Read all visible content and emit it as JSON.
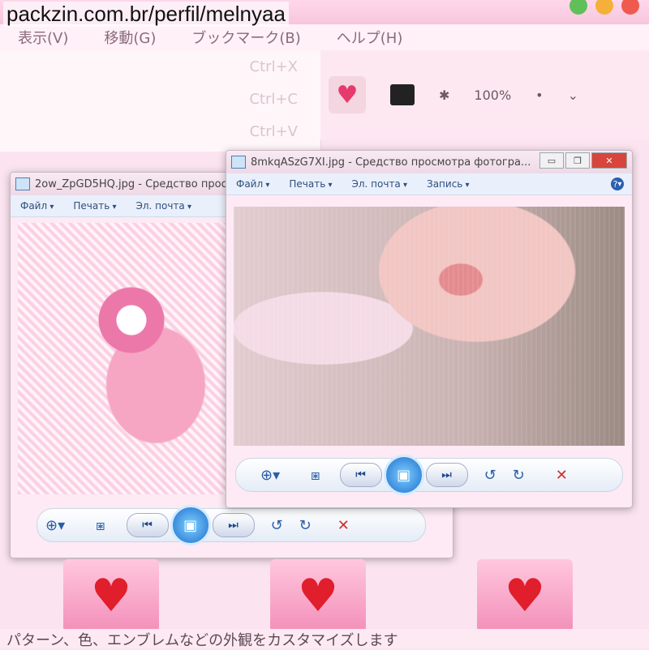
{
  "watermark": "packzin.com.br/perfil/melnyaa",
  "menubar": {
    "items": [
      "表示(V)",
      "移動(G)",
      "ブックマーク(B)",
      "ヘルプ(H)"
    ]
  },
  "dropdown": {
    "items": [
      {
        "label": "",
        "shortcut": "Ctrl+X"
      },
      {
        "label": "",
        "shortcut": "Ctrl+C"
      },
      {
        "label": "",
        "shortcut": "Ctrl+V"
      }
    ]
  },
  "toolbar": {
    "zoom_text": "100%"
  },
  "window1": {
    "title": "2ow_ZpGD5HQ.jpg - Средство прос",
    "menu": [
      "Файл",
      "Печать",
      "Эл. почта"
    ]
  },
  "window2": {
    "title": "8mkqASzG7XI.jpg - Средство просмотра фотогра...",
    "menu": [
      "Файл",
      "Печать",
      "Эл. почта",
      "Запись"
    ]
  },
  "footer": "パターン、色、エンブレムなどの外観をカスタマイズします",
  "colors": {
    "accent_pink": "#f38fba",
    "delete_red": "#cf2f2f",
    "nav_blue": "#2a5ea7"
  }
}
